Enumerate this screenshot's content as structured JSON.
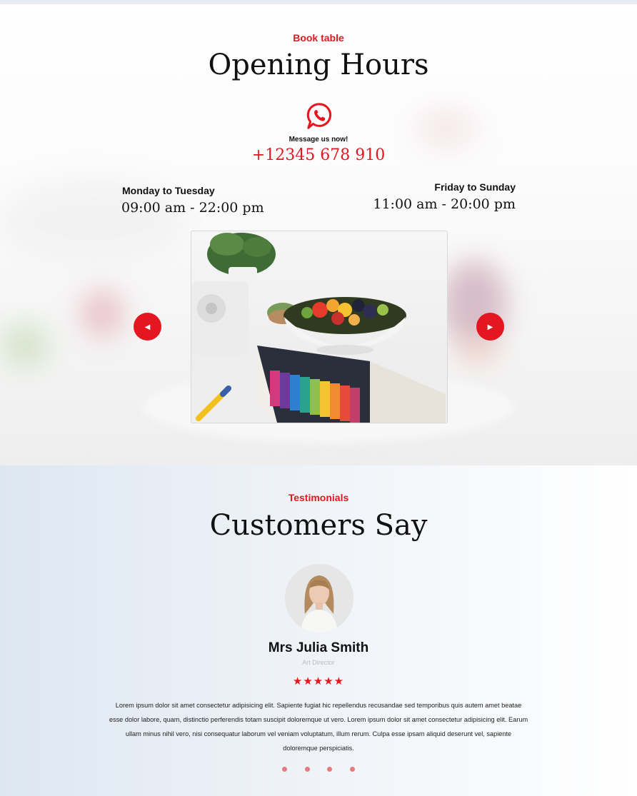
{
  "hours": {
    "eyebrow": "Book table",
    "title": "Opening Hours",
    "message_label": "Message us now!",
    "phone": "+12345 678 910",
    "schedule": [
      {
        "days": "Monday to Tuesday",
        "time": "09:00 am - 22:00 pm"
      },
      {
        "days": "Friday to Sunday",
        "time": "11:00 am - 20:00 pm"
      }
    ],
    "slider": {
      "prev_icon": "triangle-left-icon",
      "next_icon": "triangle-right-icon",
      "prev_glyph": "◀",
      "next_glyph": "▶"
    }
  },
  "testimonials": {
    "eyebrow": "Testimonials",
    "title": "Customers Say",
    "reviewer": {
      "name": "Mrs Julia Smith",
      "role": "Art Director"
    },
    "stars": "★★★★★",
    "rating": 5,
    "review": "Lorem ipsum dolor sit amet consectetur adipisicing elit. Sapiente fugiat hic repellendus recusandae sed temporibus quis autem amet beatae esse dolor labore, quam, distinctio perferendis totam suscipit doloremque ut vero. Lorem ipsum dolor sit amet consectetur adipisicing elit. Earum ullam minus nihil vero, nisi consequatur laborum vel veniam voluptatum, illum rerum. Culpa esse ipsam aliquid deserunt vel, sapiente doloremque perspiciatis.",
    "pagination_count": 4
  },
  "colors": {
    "accent": "#e4161f",
    "dot": "#e57b80",
    "text": "#111111"
  }
}
